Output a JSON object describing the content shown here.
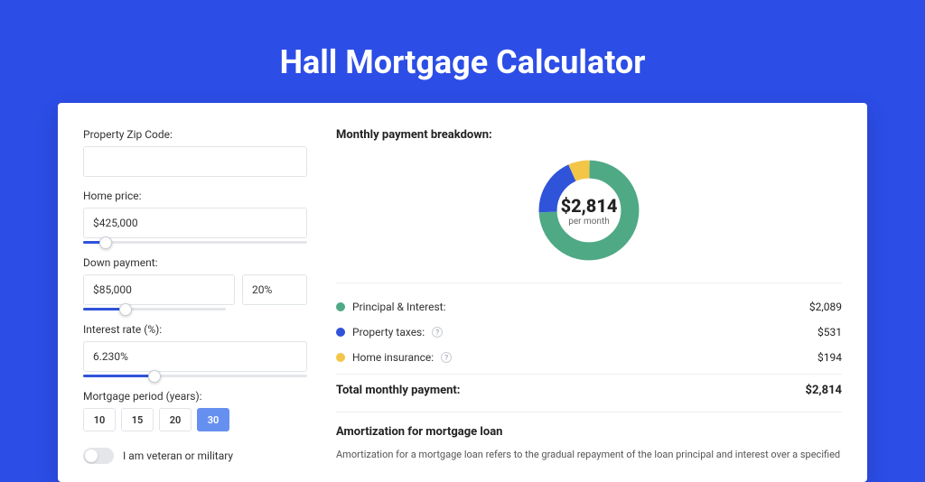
{
  "title": "Hall Mortgage Calculator",
  "form": {
    "zip_label": "Property Zip Code:",
    "zip_value": "",
    "home_price_label": "Home price:",
    "home_price_value": "$425,000",
    "home_price_slider_pct": 10,
    "down_payment_label": "Down payment:",
    "down_payment_value": "$85,000",
    "down_payment_pct": "20%",
    "down_payment_slider_pct": 20,
    "interest_label": "Interest rate (%):",
    "interest_value": "6.230%",
    "interest_slider_pct": 32,
    "period_label": "Mortgage period (years):",
    "periods": [
      "10",
      "15",
      "20",
      "30"
    ],
    "period_active": "30",
    "veteran_label": "I am veteran or military"
  },
  "breakdown": {
    "title": "Monthly payment breakdown:",
    "center_amount": "$2,814",
    "center_sub": "per month",
    "items": [
      {
        "label": "Principal & Interest:",
        "value": "$2,089",
        "color": "#4FA985",
        "has_help": false
      },
      {
        "label": "Property taxes:",
        "value": "$531",
        "color": "#2F53D9",
        "has_help": true
      },
      {
        "label": "Home insurance:",
        "value": "$194",
        "color": "#F3C648",
        "has_help": true
      }
    ],
    "total_label": "Total monthly payment:",
    "total_value": "$2,814"
  },
  "amort": {
    "title": "Amortization for mortgage loan",
    "text": "Amortization for a mortgage loan refers to the gradual repayment of the loan principal and interest over a specified"
  },
  "chart_data": {
    "type": "pie",
    "title": "Monthly payment breakdown",
    "series": [
      {
        "name": "Principal & Interest",
        "value": 2089,
        "color": "#4FA985"
      },
      {
        "name": "Property taxes",
        "value": 531,
        "color": "#2F53D9"
      },
      {
        "name": "Home insurance",
        "value": 194,
        "color": "#F3C648"
      }
    ],
    "total": 2814,
    "unit": "USD per month"
  }
}
